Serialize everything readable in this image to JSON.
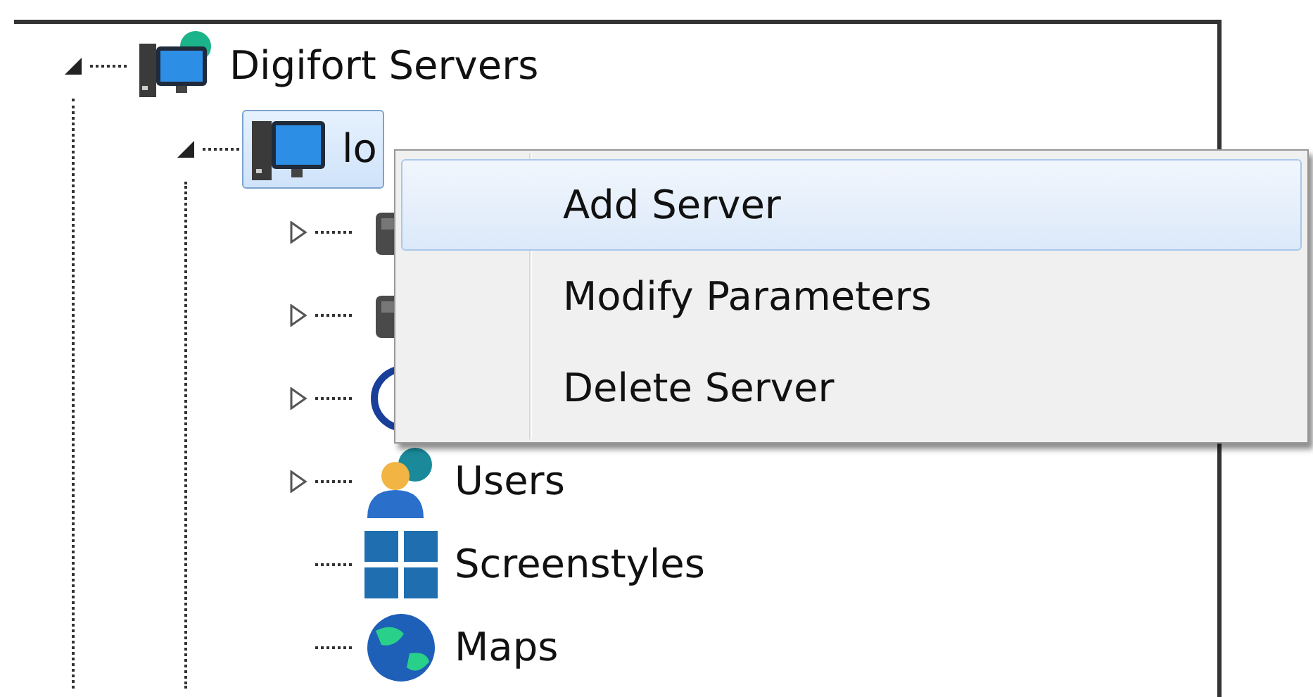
{
  "tree": {
    "nodes": [
      {
        "label": "Digifort Servers",
        "kind": "servers",
        "expanded": true,
        "selected": false,
        "children": [
          {
            "label": "lo",
            "kind": "server",
            "expanded": true,
            "selected": true,
            "children": [
              {
                "kind": "device",
                "expanded": false,
                "selected": false
              },
              {
                "kind": "device",
                "expanded": false,
                "selected": false
              },
              {
                "kind": "ring",
                "expanded": false,
                "selected": false
              },
              {
                "label": "Users",
                "kind": "users",
                "expanded": false,
                "selected": false
              },
              {
                "label": "Screenstyles",
                "kind": "layout",
                "selected": false
              },
              {
                "label": "Maps",
                "kind": "globe",
                "selected": false
              }
            ]
          }
        ]
      }
    ]
  },
  "context_menu": {
    "items": [
      {
        "label": "Add Server",
        "selected": true
      },
      {
        "label": "Modify Parameters",
        "selected": false
      },
      {
        "label": "Delete Server",
        "selected": false
      }
    ]
  }
}
